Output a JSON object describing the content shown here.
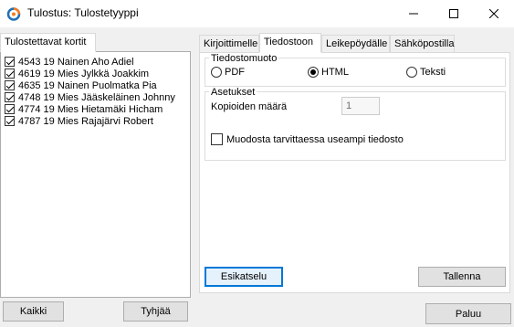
{
  "window": {
    "title": "Tulostus: Tulostetyyppi"
  },
  "left_panel": {
    "tab_label": "Tulostettavat kortit",
    "items": [
      {
        "text": "4543 19 Nainen Aho Adiel",
        "checked": true
      },
      {
        "text": "4619 19 Mies Jylkkä Joakkim",
        "checked": true
      },
      {
        "text": "4635 19 Nainen Puolmatka Pia",
        "checked": true
      },
      {
        "text": "4748 19 Mies Jääskeläinen Johnny",
        "checked": true
      },
      {
        "text": "4774 19 Mies Hietamäki Hicham",
        "checked": true
      },
      {
        "text": "4787 19 Mies Rajajärvi Robert",
        "checked": true
      }
    ],
    "buttons": {
      "all": "Kaikki",
      "clear": "Tyhjää"
    }
  },
  "tabs": [
    {
      "label": "Kirjoittimelle",
      "active": false
    },
    {
      "label": "Tiedostoon",
      "active": true
    },
    {
      "label": "Leikepöydälle",
      "active": false
    },
    {
      "label": "Sähköpostilla",
      "active": false
    }
  ],
  "file_format": {
    "group_label": "Tiedostomuoto",
    "options": [
      {
        "label": "PDF",
        "selected": false
      },
      {
        "label": "HTML",
        "selected": true
      },
      {
        "label": "Teksti",
        "selected": false
      }
    ]
  },
  "settings": {
    "group_label": "Asetukset",
    "copies_label": "Kopioiden määrä",
    "copies_value": "1",
    "multiple_files_label": "Muodosta tarvittaessa useampi tiedosto",
    "multiple_files_checked": false
  },
  "actions": {
    "preview": "Esikatselu",
    "save": "Tallenna",
    "back": "Paluu"
  },
  "colors": {
    "accent": "#0078d7",
    "app_icon_orange": "#f47b20",
    "app_icon_blue": "#1f6fb5"
  }
}
